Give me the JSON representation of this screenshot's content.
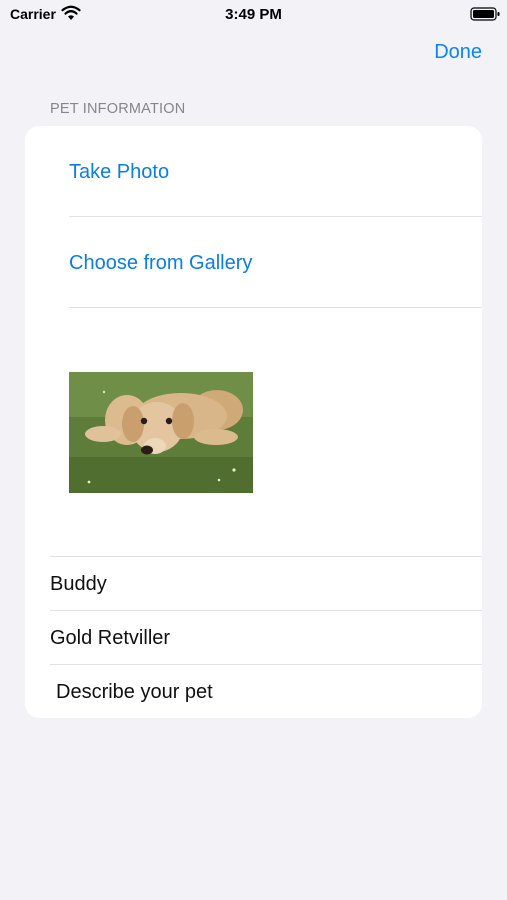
{
  "status_bar": {
    "carrier": "Carrier",
    "time": "3:49 PM"
  },
  "nav": {
    "done_label": "Done"
  },
  "section": {
    "header": "PET INFORMATION"
  },
  "photo_actions": {
    "take_photo": "Take Photo",
    "choose_gallery": "Choose from Gallery"
  },
  "fields": {
    "name": "Buddy",
    "breed": "Gold Retviller",
    "description": "Describe your pet"
  },
  "colors": {
    "accent": "#0a84ff",
    "background": "#f2f2f7",
    "card": "#ffffff",
    "section_header": "#86868b"
  },
  "icons": [
    "wifi-icon",
    "battery-icon"
  ]
}
